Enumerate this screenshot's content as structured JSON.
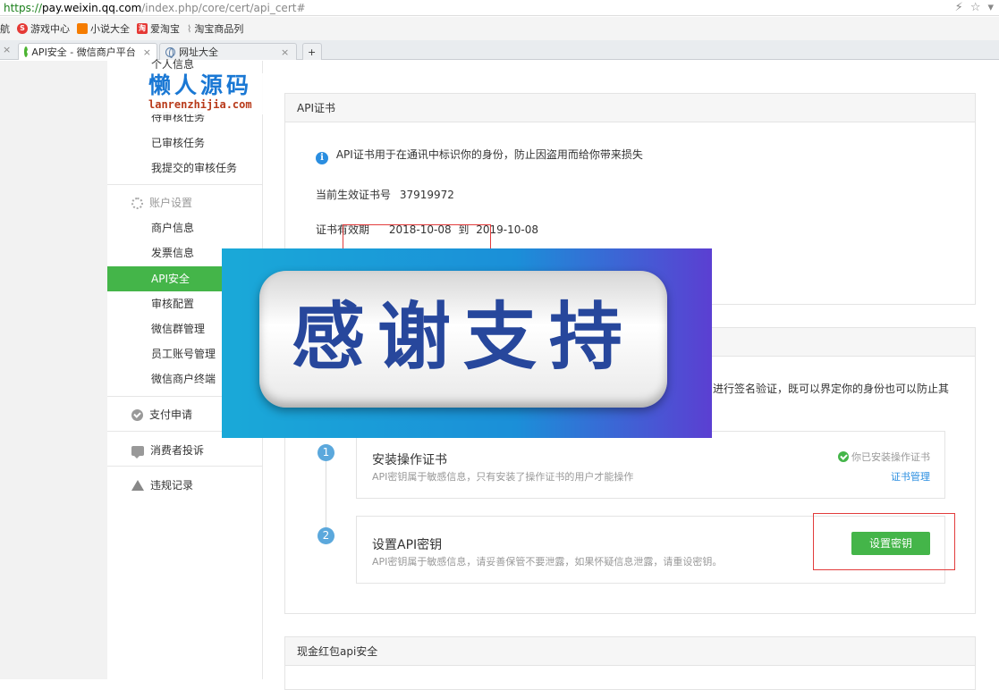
{
  "browser": {
    "url_scheme": "https://",
    "url_host": "pay.weixin.qq.com",
    "url_path": "/index.php/core/cert/api_cert#",
    "bookmarks": [
      {
        "label": "航",
        "icon": "",
        "color": ""
      },
      {
        "label": "游戏中心",
        "icon": "S",
        "color": "#e53935"
      },
      {
        "label": "小说大全",
        "icon": "",
        "color": "#f57c00"
      },
      {
        "label": "爱淘宝",
        "icon": "淘",
        "color": "#e53935"
      },
      {
        "label": "淘宝商品列",
        "icon": "",
        "color": ""
      }
    ],
    "tabs": [
      {
        "label": "API安全 - 微信商户平台"
      },
      {
        "label": "网址大全"
      }
    ],
    "new_tab_label": "+"
  },
  "sidebar": {
    "items": [
      {
        "label": "个人信息"
      },
      {
        "label": "待审核任务"
      },
      {
        "label": "已审核任务"
      },
      {
        "label": "我提交的审核任务"
      }
    ],
    "account_group": "账户设置",
    "account_items": [
      {
        "label": "商户信息"
      },
      {
        "label": "发票信息"
      },
      {
        "label": "API安全"
      },
      {
        "label": "审核配置"
      },
      {
        "label": "微信群管理"
      },
      {
        "label": "员工账号管理"
      },
      {
        "label": "微信商户终端"
      }
    ],
    "pay_apply": "支付申请",
    "complaints": "消费者投诉",
    "violations": "违规记录"
  },
  "watermark": {
    "title": "懒人源码",
    "subtitle": "lanrenzhijia.com"
  },
  "cert_panel": {
    "title": "API证书",
    "notice": "API证书用于在通讯中标识你的身份，防止因盗用而给你带来损失",
    "serial_label": "当前生效证书号",
    "serial_value": "37919972",
    "validity_label": "证书有效期",
    "validity_start": "2018-10-08",
    "validity_sep": "到",
    "validity_end": "2019-10-08"
  },
  "key_panel": {
    "desc_fragment": "进行签名验证，既可以界定你的身份也可以防止其",
    "steps": [
      {
        "num": "1",
        "title": "安装操作证书",
        "desc": "API密钥属于敏感信息，只有安装了操作证书的用户才能操作",
        "status": "你已安装操作证书",
        "link": "证书管理"
      },
      {
        "num": "2",
        "title": "设置API密钥",
        "desc": "API密钥属于敏感信息，请妥善保管不要泄露，如果怀疑信息泄露，请重设密钥。",
        "button": "设置密钥"
      }
    ]
  },
  "redpack_panel": {
    "title": "现金红包api安全"
  },
  "banner": {
    "text": "感谢支持"
  }
}
